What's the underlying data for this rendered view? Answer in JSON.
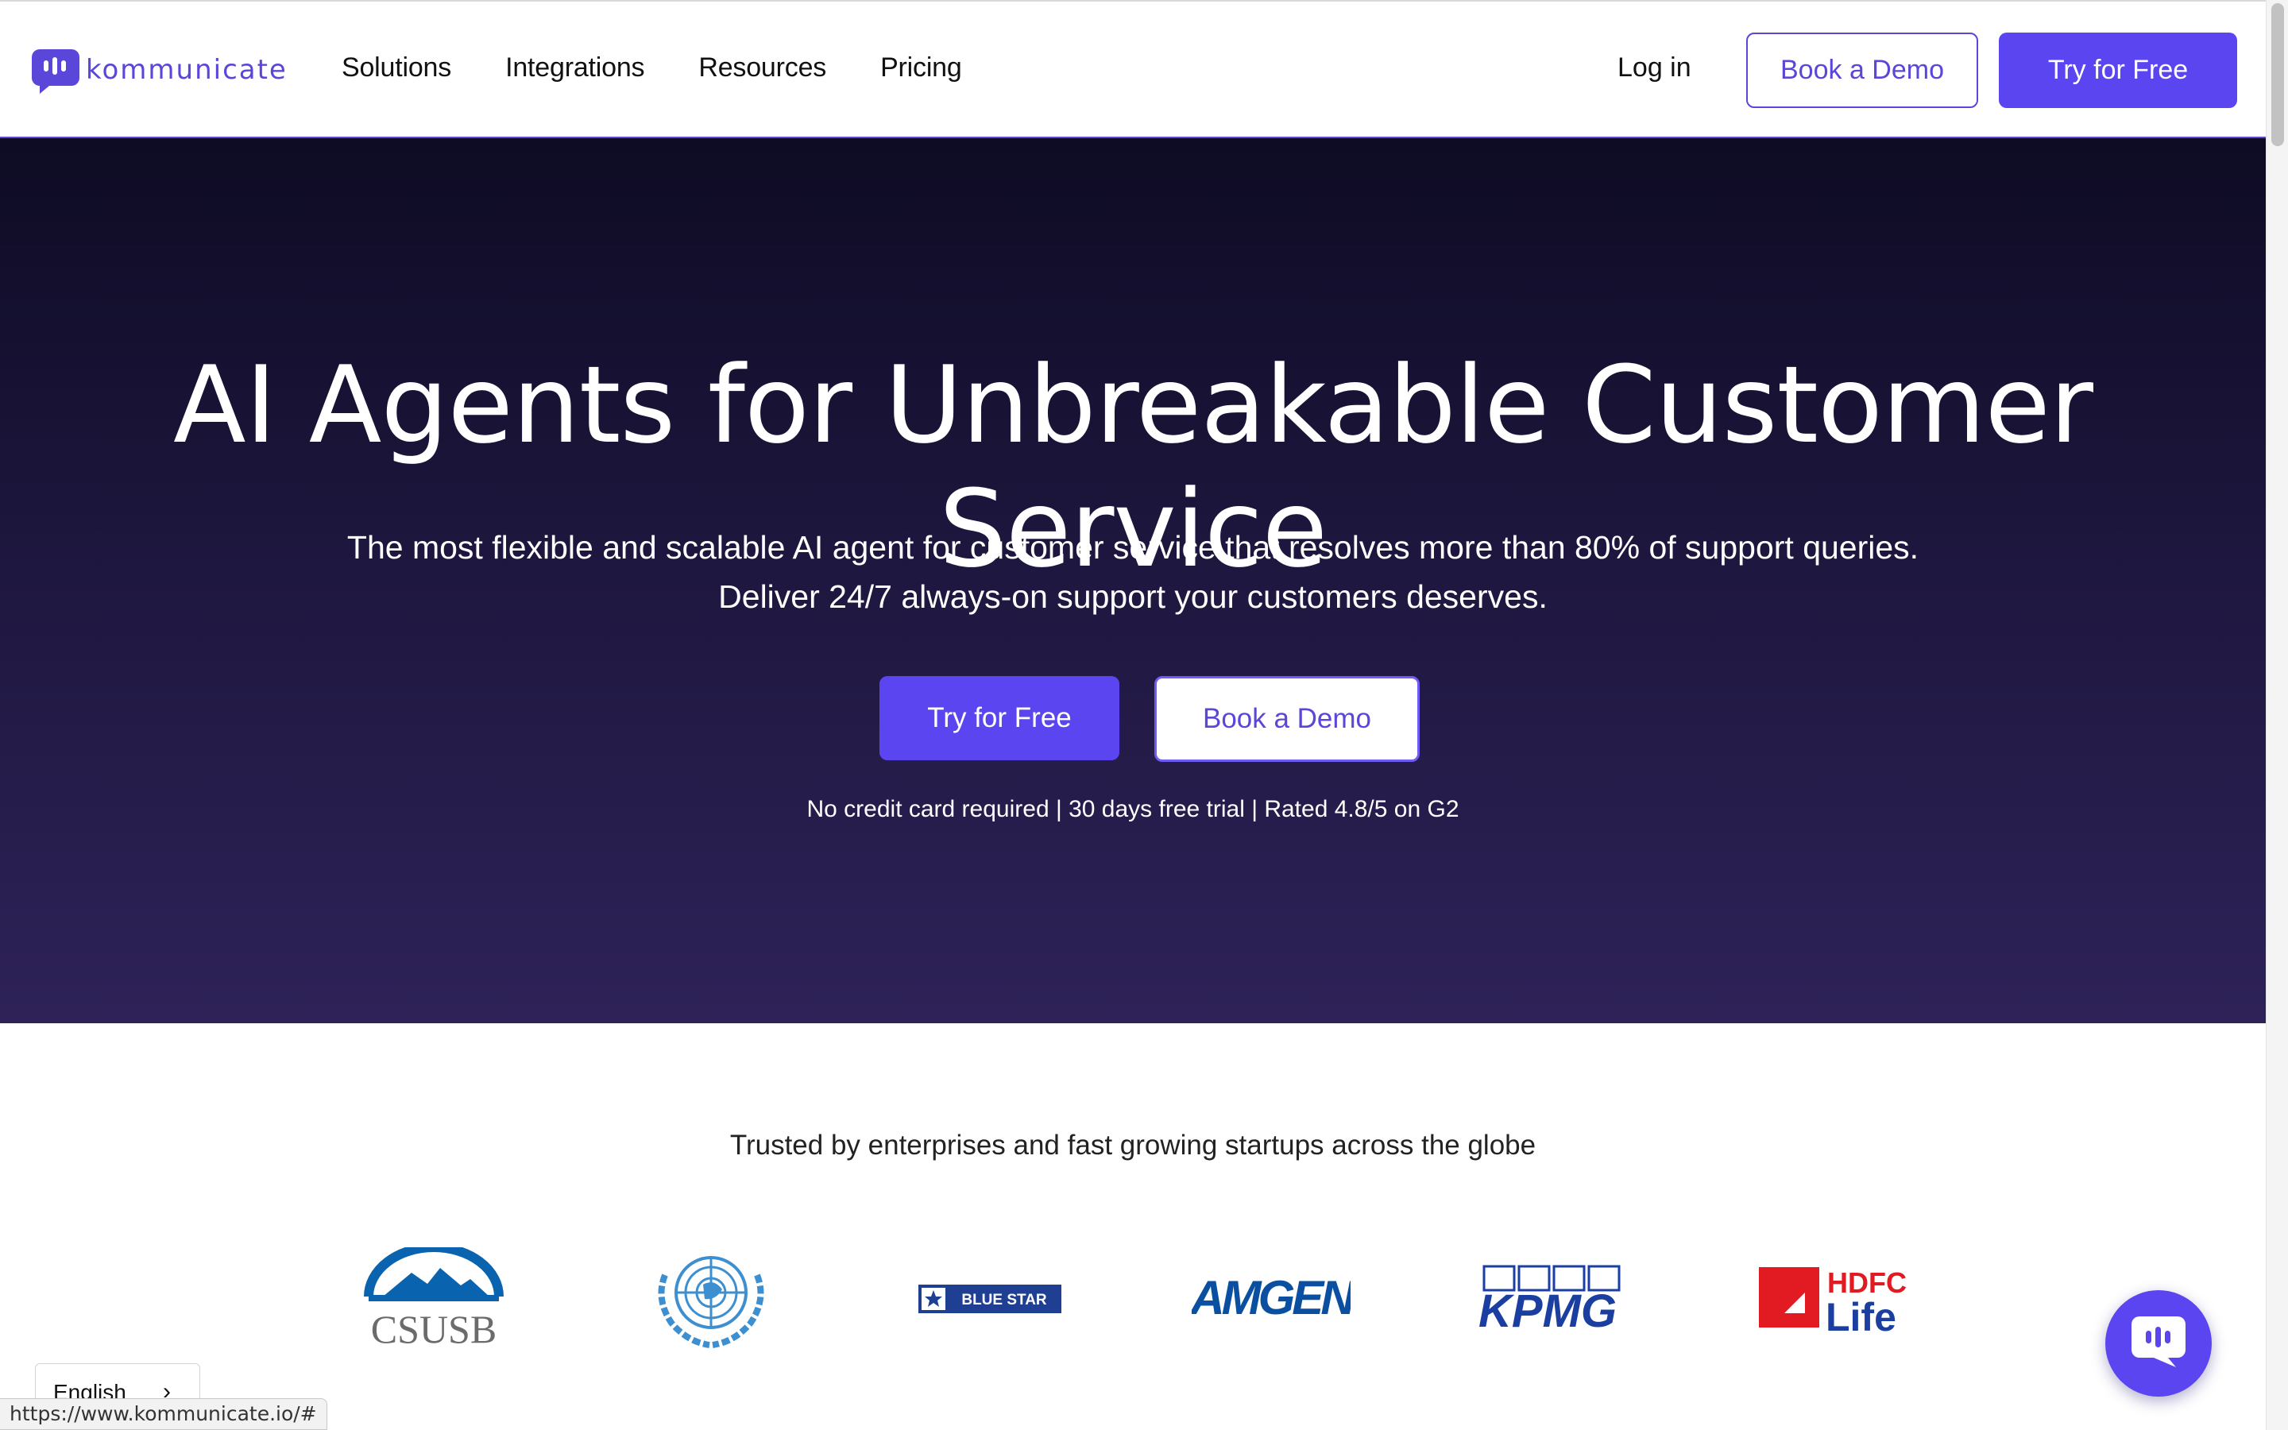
{
  "brand": {
    "name": "kommunicate",
    "accent": "#5b45f0",
    "hero_bg_top": "#0e0b24",
    "hero_bg_bottom": "#2e2258"
  },
  "nav": {
    "items": [
      {
        "label": "Solutions"
      },
      {
        "label": "Integrations"
      },
      {
        "label": "Resources"
      },
      {
        "label": "Pricing"
      }
    ],
    "login": "Log in",
    "book_demo": "Book a Demo",
    "try_free": "Try for Free"
  },
  "hero": {
    "title": "AI Agents for Unbreakable Customer Service",
    "subtitle_line1": "The most flexible and scalable AI agent for customer service that resolves more than 80% of support queries.",
    "subtitle_line2": "Deliver 24/7 always-on support your customers deserves.",
    "cta_primary": "Try for Free",
    "cta_secondary": "Book a Demo",
    "note": "No credit card required | 30 days free trial | Rated 4.8/5 on G2"
  },
  "trusted": {
    "heading": "Trusted by enterprises and fast growing startups across the globe",
    "logos": [
      {
        "name": "CSUSB",
        "icon": "csusb-logo"
      },
      {
        "name": "United Nations",
        "icon": "un-emblem-logo"
      },
      {
        "name": "BLUE STAR",
        "icon": "bluestar-logo"
      },
      {
        "name": "AMGEN",
        "icon": "amgen-logo"
      },
      {
        "name": "KPMG",
        "icon": "kpmg-logo"
      },
      {
        "name": "HDFC Life",
        "icon": "hdfc-life-logo",
        "line1": "HDFC",
        "line2": "Life"
      }
    ]
  },
  "language": {
    "selected": "English"
  },
  "status_bar": {
    "url": "https://www.kommunicate.io/#"
  },
  "chat_widget": {
    "icon": "chat-bubble-icon"
  }
}
